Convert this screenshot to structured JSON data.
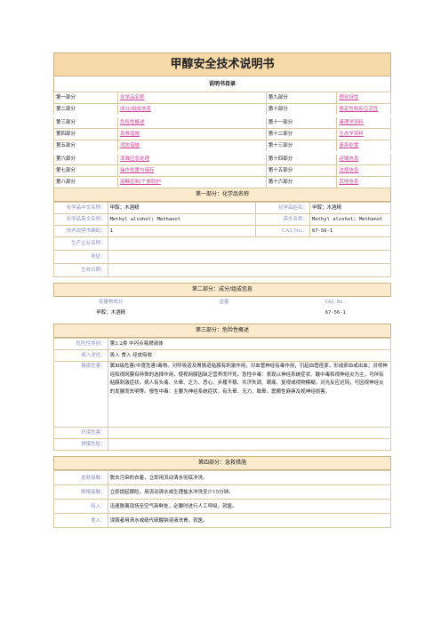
{
  "title": "甲醇安全技术说明书",
  "toc_title": "说明书目录",
  "toc": [
    [
      "第一部分",
      "化学品名称",
      "第九部分",
      "理化特性"
    ],
    [
      "第二部分",
      "成分/组成信息",
      "第十部分",
      "稳定性和反应活性"
    ],
    [
      "第三部分",
      "危险性概述",
      "第十一部分",
      "毒理学资料"
    ],
    [
      "第四部分",
      "急救措施",
      "第十二部分",
      "生态学资料"
    ],
    [
      "第五部分",
      "消防措施",
      "第十三部分",
      "废弃处置"
    ],
    [
      "第六部分",
      "泄漏应急处理",
      "第十四部分",
      "运输信息"
    ],
    [
      "第七部分",
      "操作处置与储存",
      "第十五部分",
      "法规信息"
    ],
    [
      "第八部分",
      "接触控制/个体防护",
      "第十六部分",
      "其他信息"
    ]
  ],
  "s1": {
    "header": "第一部分：化学品名称",
    "cn_name_label": "化学品中文名称：",
    "cn_name": "甲醇；木酒精",
    "cn_alias_label": "化学品俗名：",
    "cn_alias": "甲醇；木酒精",
    "en_name_label": "化学品英文名称：",
    "en_name": "Methyl alcohol; Methanol",
    "en_alias_label": "英文名称：",
    "en_alias": "Methyl alcohol; Methanol",
    "code_label": "技术说明书编码：",
    "code": "1",
    "cas_label": "CAS No.：",
    "cas": "67-56-1",
    "maker_label": "生产企业名称：",
    "addr_label": "地址：",
    "date_label": "生效日期："
  },
  "s2": {
    "header": "第二部分：成分/组成信息",
    "col1": "有害物成分",
    "col2": "含量",
    "col3": "CAS No.",
    "row_name": "甲醇；木酒精",
    "row_content": "",
    "row_cas": "67-56-1"
  },
  "s3": {
    "header": "第三部分：危险性概述",
    "class_label": "危险性类别：",
    "class": "第3.2类 中闪点易燃液体",
    "route_label": "侵入途径：",
    "route": "吸入 食入 经皮吸收",
    "health_label": "健康危害：",
    "health": "属Ⅲ级危害(中度危害)毒物。对呼吸道及胃肠道粘膜有刺激作用，对血管神经有毒作用，引起血管痉挛，形成瘀血或出血；对视神经和视网膜有特殊的选择作用，使视网膜因缺乏营养而坏死。急性中毒：表现以神经系统症状、酸中毒和视神经炎为主，可伴有粘膜刺激症状。病人有头痛、头晕、乏力、恶心、步履不稳、共济失调、眼痛、复视或视物模糊，对光反应迟钝，可因视神经炎的发展而失明等。慢性中毒：主要为神经系统症状，有头晕、无力、眩晕，震颤性麻痹及视神经损害。",
    "env_label": "环境危害：",
    "burn_label": "燃爆危险："
  },
  "s4": {
    "header": "第四部分：急救措施",
    "skin_label": "皮肤接触：",
    "skin": "脱去污染的衣着，立即用流动清水彻底冲洗。",
    "eye_label": "眼睛接触：",
    "eye": "立即提起眼睑，用流动清水或生理盐水冲洗至少15分钟。",
    "inh_label": "吸入：",
    "inh": "迅速脱离现场至空气新鲜处，必要时进行人工呼吸，就医。",
    "ing_label": "食入：",
    "ing": "误服者用清水或硫代硫酸钠溶液洗胃，就医。"
  }
}
